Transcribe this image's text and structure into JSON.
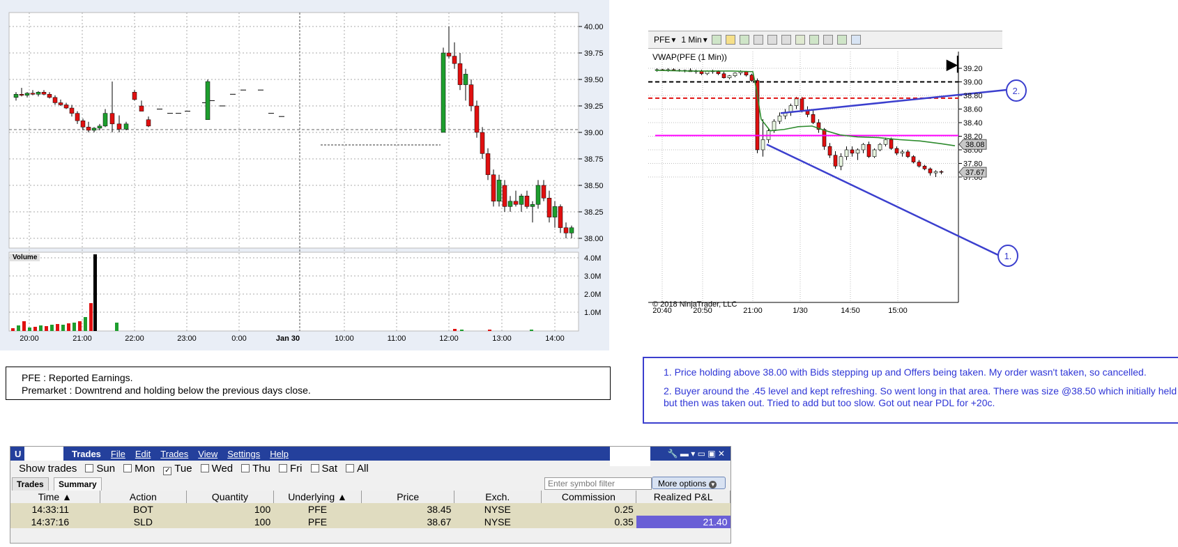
{
  "left_chart": {
    "price_ticks": [
      "40.00",
      "39.75",
      "39.50",
      "39.25",
      "39.00",
      "38.75",
      "38.50",
      "38.25",
      "38.00"
    ],
    "volume_label": "Volume",
    "volume_ticks": [
      "4.0M",
      "3.0M",
      "2.0M",
      "1.0M"
    ],
    "time_ticks": [
      "20:00",
      "21:00",
      "22:00",
      "23:00",
      "0:00",
      "Jan 30",
      "10:00",
      "11:00",
      "12:00",
      "13:00",
      "14:00"
    ]
  },
  "right_chart": {
    "toolbar": {
      "symbol": "PFE",
      "interval": "1 Min"
    },
    "indicator_label": "VWAP(PFE (1 Min))",
    "price_ticks": [
      "39.20",
      "39.00",
      "38.80",
      "38.60",
      "38.40",
      "38.20",
      "38.00",
      "37.80",
      "37.60"
    ],
    "vwap_badge": "38.08",
    "last_badge": "37.67",
    "time_ticks": [
      "20:40",
      "20:50",
      "21:00",
      "1/30",
      "14:50",
      "15:00"
    ],
    "copyright": "© 2018 NinjaTrader, LLC",
    "callout_1": "1.",
    "callout_2": "2.",
    "colors": {
      "vwap": "#2e8b2e",
      "pdl": "#e01010",
      "magenta": "#ff00ff",
      "annot": "#3b3fce"
    }
  },
  "notes_left": {
    "line1": "PFE : Reported Earnings.",
    "line2": "Premarket : Downtrend and holding below the previous days close."
  },
  "notes_right": {
    "p1": "1. Price holding above 38.00 with Bids stepping up and Offers being taken. My order wasn't taken, so cancelled.",
    "p2": "2. Buyer around the .45 level and kept refreshing. So went long in that area. There was size @38.50 which initially held but then was taken out. Tried to add but too slow. Got out near PDL for +20c."
  },
  "trades_window": {
    "title_prefix": "U",
    "title": "Trades",
    "menus": [
      "File",
      "Edit",
      "Trades",
      "View",
      "Settings",
      "Help"
    ],
    "show_trades_label": "Show trades",
    "days": [
      {
        "label": "Sun",
        "checked": false
      },
      {
        "label": "Mon",
        "checked": false
      },
      {
        "label": "Tue",
        "checked": true
      },
      {
        "label": "Wed",
        "checked": false
      },
      {
        "label": "Thu",
        "checked": false
      },
      {
        "label": "Fri",
        "checked": false
      },
      {
        "label": "Sat",
        "checked": false
      },
      {
        "label": "All",
        "checked": false
      }
    ],
    "tabs": [
      "Trades",
      "Summary"
    ],
    "filter_placeholder": "Enter symbol filter",
    "more_options": "More options",
    "columns": [
      "Time",
      "Action",
      "Quantity",
      "Underlying",
      "Price",
      "Exch.",
      "Commission",
      "Realized P&L"
    ],
    "rows": [
      {
        "time": "14:33:11",
        "action": "BOT",
        "quantity": "100",
        "underlying": "PFE",
        "price": "38.45",
        "exch": "NYSE",
        "commission": "0.25",
        "pnl": ""
      },
      {
        "time": "14:37:16",
        "action": "SLD",
        "quantity": "100",
        "underlying": "PFE",
        "price": "38.67",
        "exch": "NYSE",
        "commission": "0.35",
        "pnl": "21.40"
      }
    ]
  }
}
